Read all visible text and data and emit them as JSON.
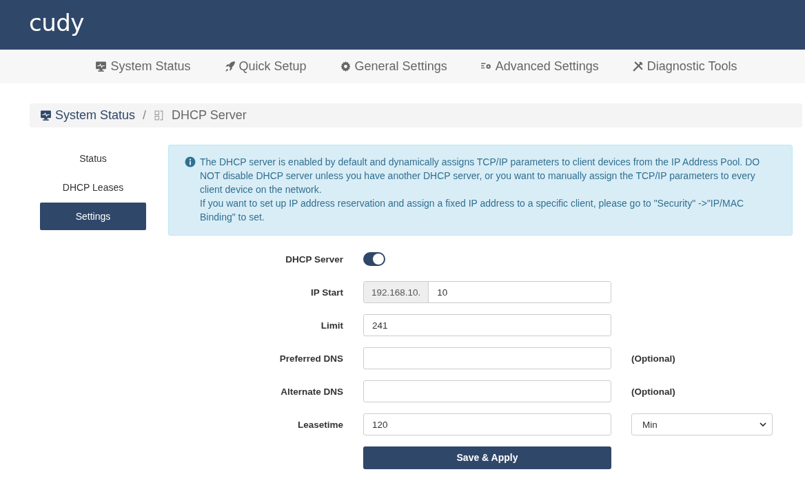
{
  "header": {
    "logo": "cudy"
  },
  "nav": [
    {
      "label": "System Status",
      "kind": "status"
    },
    {
      "label": "Quick Setup",
      "kind": "setup"
    },
    {
      "label": "General Settings",
      "kind": "general"
    },
    {
      "label": "Advanced Settings",
      "kind": "advanced"
    },
    {
      "label": "Diagnostic Tools",
      "kind": "diagnostic"
    }
  ],
  "breadcrumb": {
    "parent": "System Status",
    "separator": "/",
    "current": "DHCP Server"
  },
  "sidebar": {
    "items": [
      {
        "label": "Status",
        "selected": false
      },
      {
        "label": "DHCP Leases",
        "selected": false
      },
      {
        "label": "Settings",
        "selected": true
      }
    ]
  },
  "info": {
    "paragraphs": [
      "The DHCP server is enabled by default and dynamically assigns TCP/IP parameters to client devices from the IP Address Pool. DO NOT disable DHCP server unless you have another DHCP server, or you want to manually assign the TCP/IP parameters to every client device on the network.",
      "If you want to set up IP address reservation and assign a fixed IP address to a specific client, please go to \"Security\" ->\"IP/MAC Binding\" to set."
    ]
  },
  "form": {
    "rows": [
      {
        "kind": "toggle",
        "label": "DHCP Server",
        "on": true
      },
      {
        "kind": "prefixed",
        "label": "IP Start",
        "prefix": "192.168.10.",
        "value": "10"
      },
      {
        "kind": "text",
        "label": "Limit",
        "value": "241"
      },
      {
        "kind": "text",
        "label": "Preferred DNS",
        "note": "(Optional)"
      },
      {
        "kind": "text",
        "label": "Alternate DNS",
        "note": "(Optional)"
      },
      {
        "kind": "select",
        "label": "Leasetime",
        "value": "120",
        "unit": "Min"
      }
    ],
    "save_button": "Save & Apply"
  }
}
